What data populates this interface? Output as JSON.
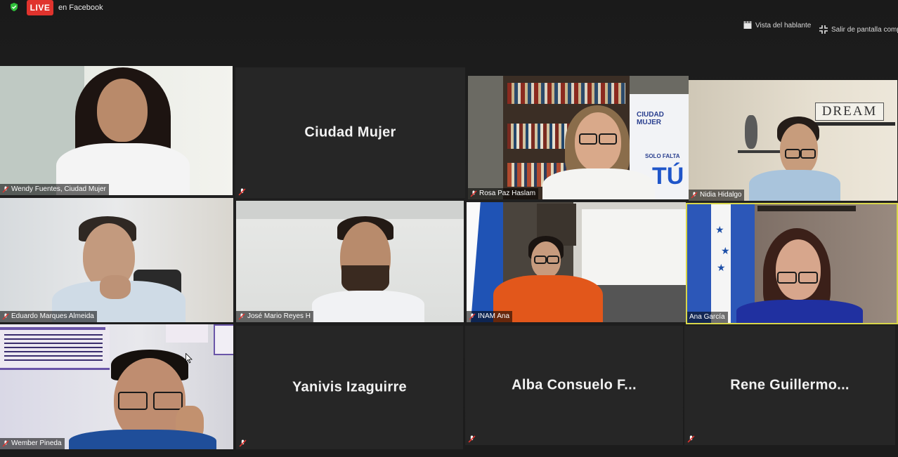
{
  "header": {
    "live_badge": "LIVE",
    "live_destination": "en Facebook",
    "speaker_view_label": "Vista del hablante",
    "exit_fullscreen_label": "Salir de pantalla comple"
  },
  "icons": {
    "security": "shield-check-icon",
    "speaker_view": "speaker-view-icon",
    "exit_fullscreen": "exit-fullscreen-icon",
    "muted_mic": "microphone-muted-icon"
  },
  "colors": {
    "live_red": "#e0332d",
    "active_speaker_border": "#d8d64a",
    "mute_red": "#e0332d",
    "shield_green": "#2fbf3a"
  },
  "participants": [
    {
      "name": "Wendy Fuentes, Ciudad Mujer",
      "video": true,
      "muted": true
    },
    {
      "name": "Ciudad Mujer",
      "video": false,
      "muted": true
    },
    {
      "name": "Rosa Paz Haslam",
      "video": true,
      "muted": true
    },
    {
      "name": "Nidia Hidalgo",
      "video": true,
      "muted": true
    },
    {
      "name": "Eduardo Marques Almeida",
      "video": true,
      "muted": true
    },
    {
      "name": "José Mario Reyes H",
      "video": true,
      "muted": true
    },
    {
      "name": "INAM Ana",
      "video": true,
      "muted": true
    },
    {
      "name": "Ana García",
      "video": true,
      "muted": false,
      "active_speaker": true
    },
    {
      "name": "Wember Pineda",
      "video": true,
      "muted": true
    },
    {
      "name": "Yanivis Izaguirre",
      "video": false,
      "muted": true
    },
    {
      "name": "Alba Consuelo F...",
      "video": false,
      "muted": true
    },
    {
      "name": "Rene  Guillermo...",
      "video": false,
      "muted": true
    }
  ],
  "scene_text": {
    "wall_sign": "DREAM",
    "banner_brand": "CIUDAD MUJER",
    "banner_slogan": "SOLO FALTA",
    "banner_big": "TÚ"
  }
}
